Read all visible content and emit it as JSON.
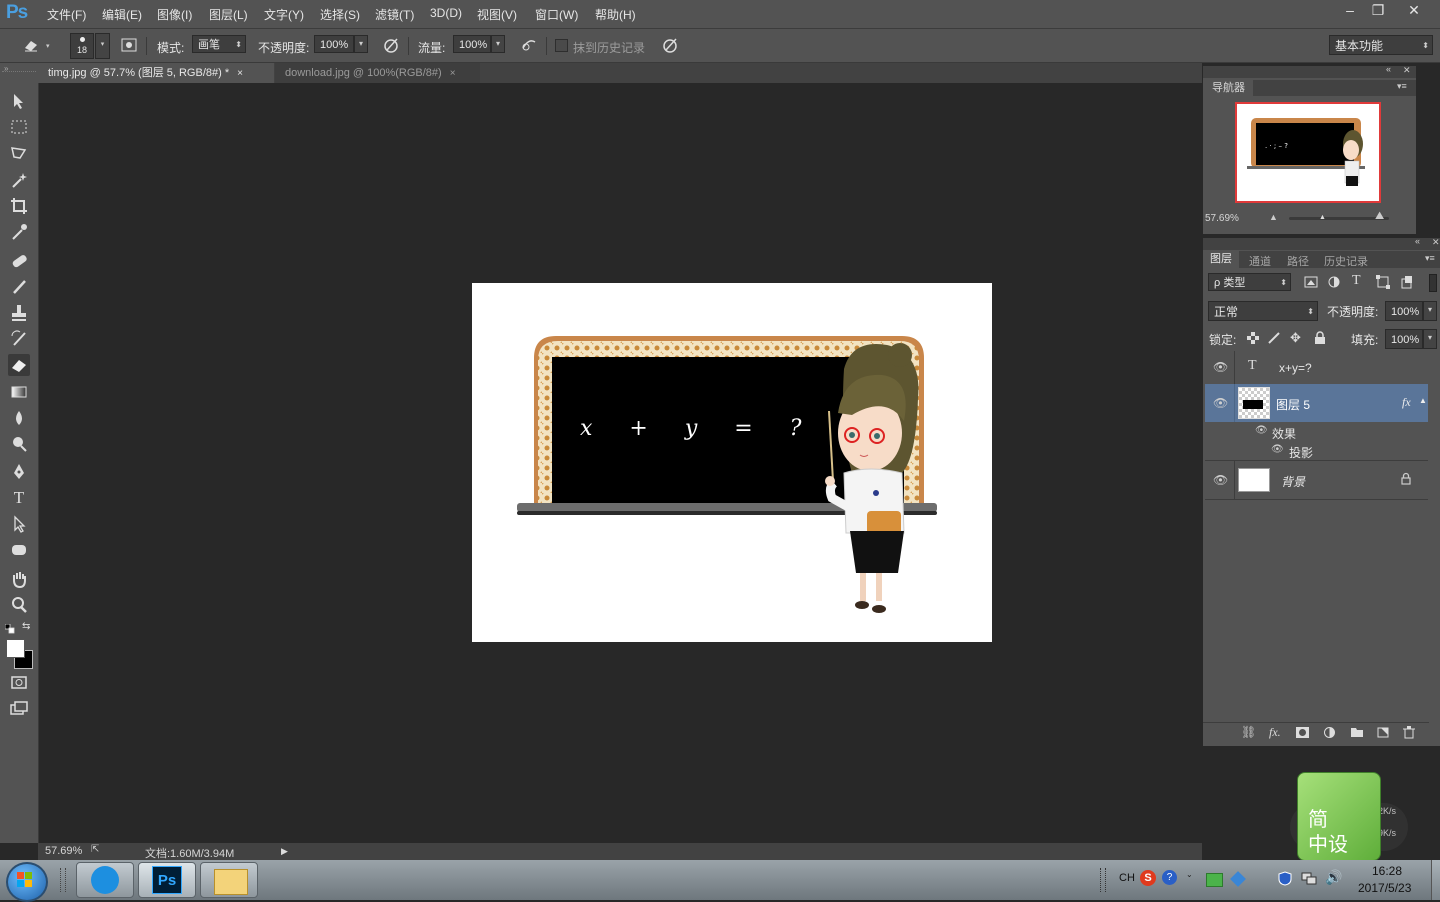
{
  "app": {
    "logo": "Ps"
  },
  "menu": [
    "文件(F)",
    "编辑(E)",
    "图像(I)",
    "图层(L)",
    "文字(Y)",
    "选择(S)",
    "滤镜(T)",
    "3D(D)",
    "视图(V)",
    "窗口(W)",
    "帮助(H)"
  ],
  "window_buttons": {
    "minimize": "–",
    "restore": "❐",
    "close": "✕"
  },
  "options": {
    "brush_size": "18",
    "mode_label": "模式:",
    "mode_value": "画笔",
    "opacity_label": "不透明度:",
    "opacity_value": "100%",
    "flow_label": "流量:",
    "flow_value": "100%",
    "erase_history_label": "抹到历史记录",
    "workspace": "基本功能"
  },
  "tabs": [
    {
      "label": "timg.jpg @ 57.7% (图层 5, RGB/8#) *",
      "close": "×"
    },
    {
      "label": "download.jpg @ 100%(RGB/8#)",
      "close": "×"
    }
  ],
  "canvas_art": {
    "equation": "x + y = ?"
  },
  "status": {
    "zoom": "57.69%",
    "doc": "文档:1.60M/3.94M"
  },
  "navigator": {
    "title": "导航器",
    "zoom": "57.69%",
    "thumb_text": ". · ; – ?"
  },
  "layers_panel": {
    "tabs": [
      "图层",
      "通道",
      "路径",
      "历史记录"
    ],
    "filter": "ρ 类型",
    "blend_mode": "正常",
    "opacity_label": "不透明度:",
    "opacity_value": "100%",
    "lock_label": "锁定:",
    "fill_label": "填充:",
    "fill_value": "100%",
    "layers": [
      {
        "name": "x+y=?",
        "kind": "text",
        "type_glyph": "T"
      },
      {
        "name": "图层 5",
        "kind": "pixel",
        "fx": "fx"
      },
      {
        "name": "背景",
        "kind": "background"
      }
    ],
    "effects_label": "效果",
    "effect_item": "投影",
    "footer_fx": "fx."
  },
  "taskbar": {
    "ime": "CH",
    "time": "16:28",
    "date": "2017/5/23",
    "widget_line1": "简",
    "widget_line2": "中设",
    "net_up": "2K/s",
    "net_down": "9K/s"
  }
}
